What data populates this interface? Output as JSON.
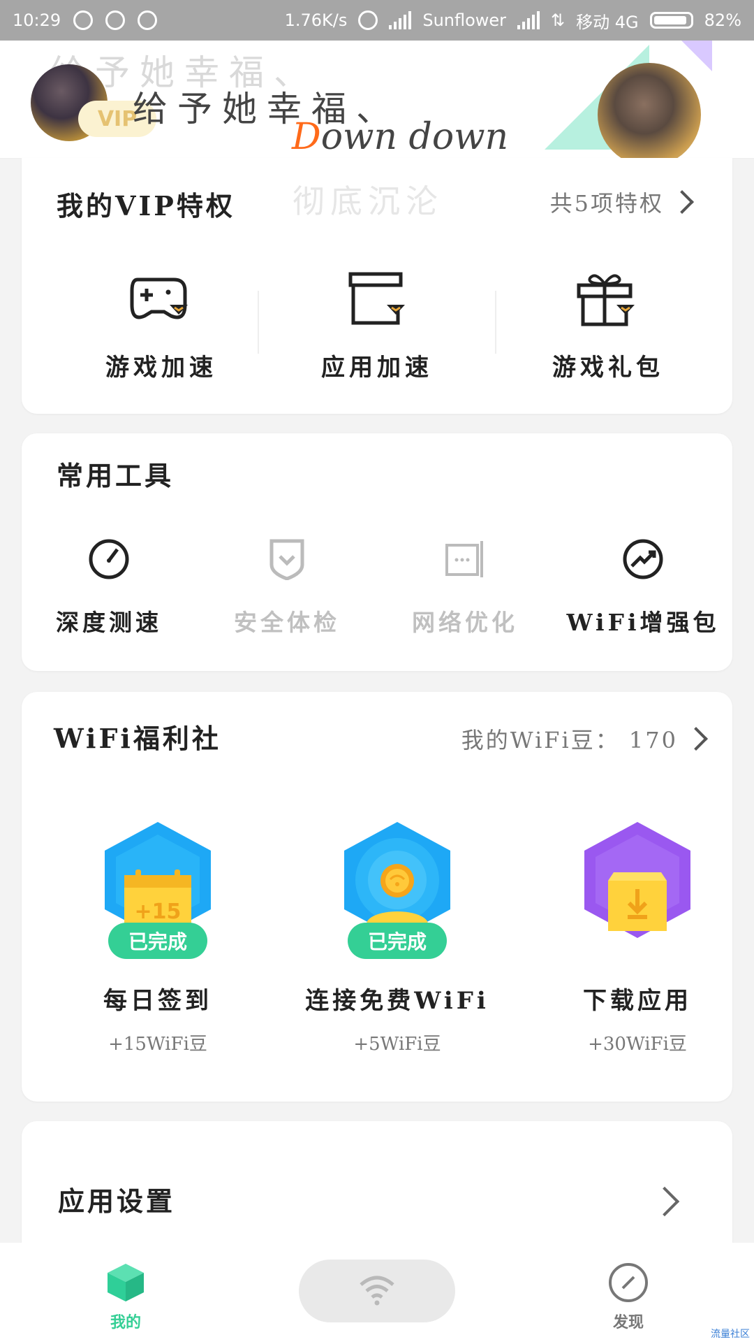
{
  "status_bar": {
    "time": "10:29",
    "speed": "1.76K/s",
    "carrier1": "Sunflower",
    "carrier2": "移动 4G",
    "battery": "82%"
  },
  "header": {
    "ghost_text": "给予她幸福、",
    "title": "给予她幸福、",
    "subtitle": "Down down",
    "vip_badge": "VIP"
  },
  "vip_section": {
    "title": "我的VIP特权",
    "ghost": "彻底沉沦",
    "link": "共5项特权",
    "items": [
      {
        "label": "游戏加速",
        "icon": "gamepad-icon"
      },
      {
        "label": "应用加速",
        "icon": "box-icon"
      },
      {
        "label": "游戏礼包",
        "icon": "gift-icon"
      }
    ]
  },
  "tools_section": {
    "title": "常用工具",
    "items": [
      {
        "label": "深度测速",
        "icon": "speedometer-icon",
        "enabled": true
      },
      {
        "label": "安全体检",
        "icon": "shield-icon",
        "enabled": false
      },
      {
        "label": "网络优化",
        "icon": "network-icon",
        "enabled": false
      },
      {
        "label": "WiFi增强包",
        "icon": "trend-icon",
        "enabled": true
      }
    ]
  },
  "welfare_section": {
    "title": "WiFi福利社",
    "link": "我的WiFi豆： 170",
    "items": [
      {
        "name": "每日签到",
        "points": "+15WiFi豆",
        "status": "已完成",
        "icon": "calendar-icon",
        "calendar_text": "+15"
      },
      {
        "name": "连接免费WiFi",
        "points": "+5WiFi豆",
        "status": "已完成",
        "icon": "coin-icon"
      },
      {
        "name": "下载应用",
        "points": "+30WiFi豆",
        "status": "",
        "icon": "download-box-icon"
      }
    ]
  },
  "settings": {
    "label": "应用设置"
  },
  "bottom_nav": {
    "mine": "我的",
    "discover": "发现"
  },
  "watermark": "流量社区",
  "colors": {
    "accent_green": "#34cf95",
    "blue": "#1ea8f5",
    "purple": "#9a58f0",
    "yellow": "#ffd23c"
  }
}
